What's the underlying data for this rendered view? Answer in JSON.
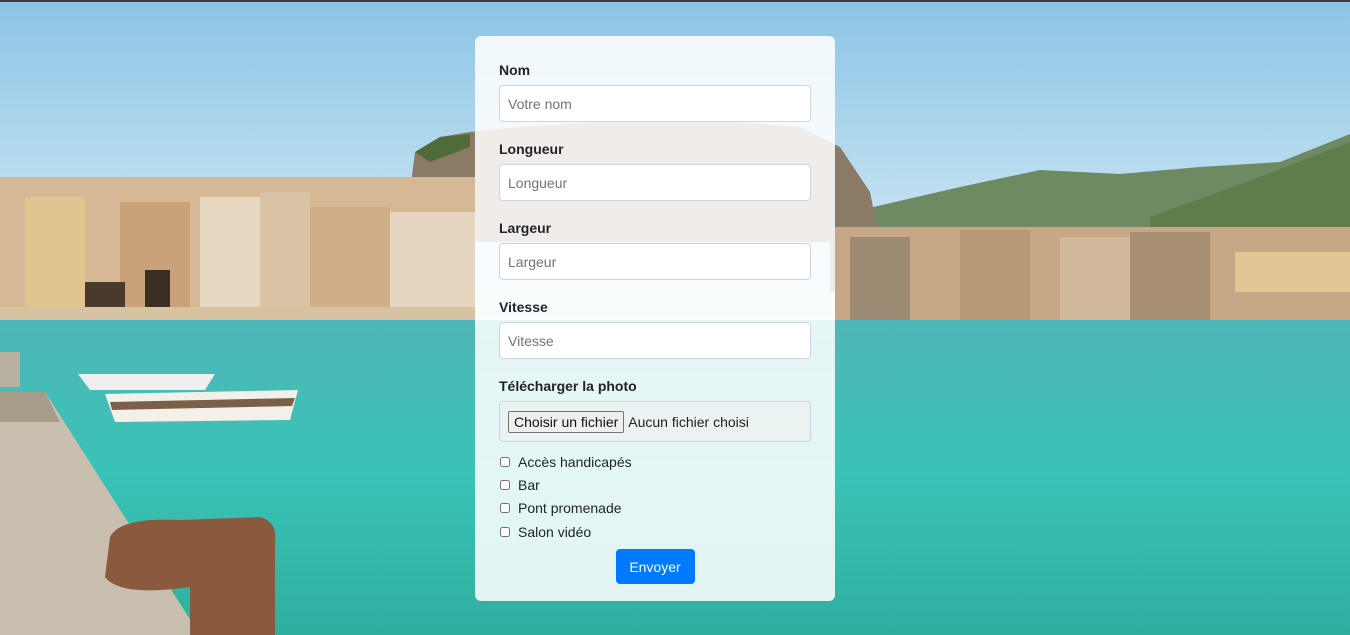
{
  "form": {
    "fields": [
      {
        "label": "Nom",
        "placeholder": "Votre nom"
      },
      {
        "label": "Longueur",
        "placeholder": "Longueur"
      },
      {
        "label": "Largeur",
        "placeholder": "Largeur"
      },
      {
        "label": "Vitesse",
        "placeholder": "Vitesse"
      }
    ],
    "upload": {
      "label": "Télécharger la photo",
      "button": "Choisir un fichier",
      "status": "Aucun fichier choisi"
    },
    "options": [
      {
        "label": "Accès handicapés",
        "checked": false
      },
      {
        "label": "Bar",
        "checked": false
      },
      {
        "label": "Pont promenade",
        "checked": false
      },
      {
        "label": "Salon vidéo",
        "checked": false
      }
    ],
    "submit_label": "Envoyer"
  },
  "colors": {
    "accent": "#007bff",
    "sea": "#3fbfb5",
    "sky": "#a9d3ee"
  }
}
